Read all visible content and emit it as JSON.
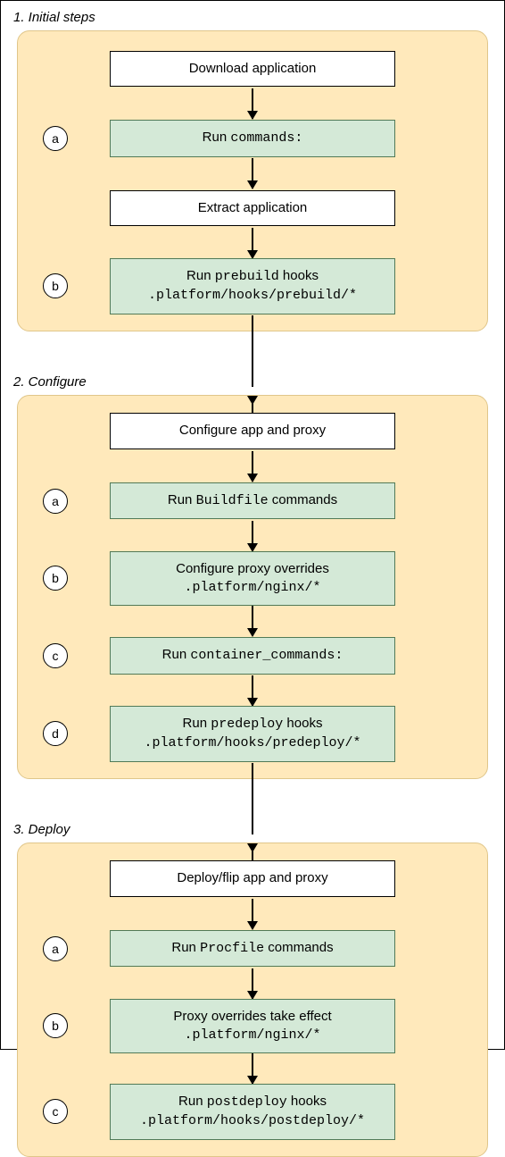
{
  "chart_data": {
    "type": "flowchart",
    "phases": [
      {
        "id": 1,
        "title": "1. Initial steps",
        "header_box": "Download application",
        "steps": [
          {
            "bullet": "a",
            "line1_pre": "Run ",
            "line1_code": "commands:",
            "line1_post": ""
          },
          {
            "plain": "Extract application"
          },
          {
            "bullet": "b",
            "line1_pre": "Run ",
            "line1_code": "prebuild",
            "line1_post": " hooks",
            "line2_code": ".platform/hooks/prebuild/*"
          }
        ]
      },
      {
        "id": 2,
        "title": "2. Configure",
        "header_box": "Configure app and proxy",
        "steps": [
          {
            "bullet": "a",
            "line1_pre": "Run ",
            "line1_code": "Buildfile",
            "line1_post": " commands"
          },
          {
            "bullet": "b",
            "line1_pre": "Configure proxy overrides",
            "line1_code": "",
            "line1_post": "",
            "line2_code": ".platform/nginx/*"
          },
          {
            "bullet": "c",
            "line1_pre": "Run ",
            "line1_code": "container_commands:",
            "line1_post": ""
          },
          {
            "bullet": "d",
            "line1_pre": "Run ",
            "line1_code": "predeploy",
            "line1_post": " hooks",
            "line2_code": ".platform/hooks/predeploy/*"
          }
        ]
      },
      {
        "id": 3,
        "title": "3. Deploy",
        "header_box": "Deploy/flip app and proxy",
        "steps": [
          {
            "bullet": "a",
            "line1_pre": "Run ",
            "line1_code": "Procfile",
            "line1_post": " commands"
          },
          {
            "bullet": "b",
            "line1_pre": "Proxy overrides take effect",
            "line1_code": "",
            "line1_post": "",
            "line2_code": ".platform/nginx/*"
          },
          {
            "bullet": "c",
            "line1_pre": "Run ",
            "line1_code": "postdeploy",
            "line1_post": " hooks",
            "line2_code": ".platform/hooks/postdeploy/*"
          }
        ]
      }
    ]
  }
}
